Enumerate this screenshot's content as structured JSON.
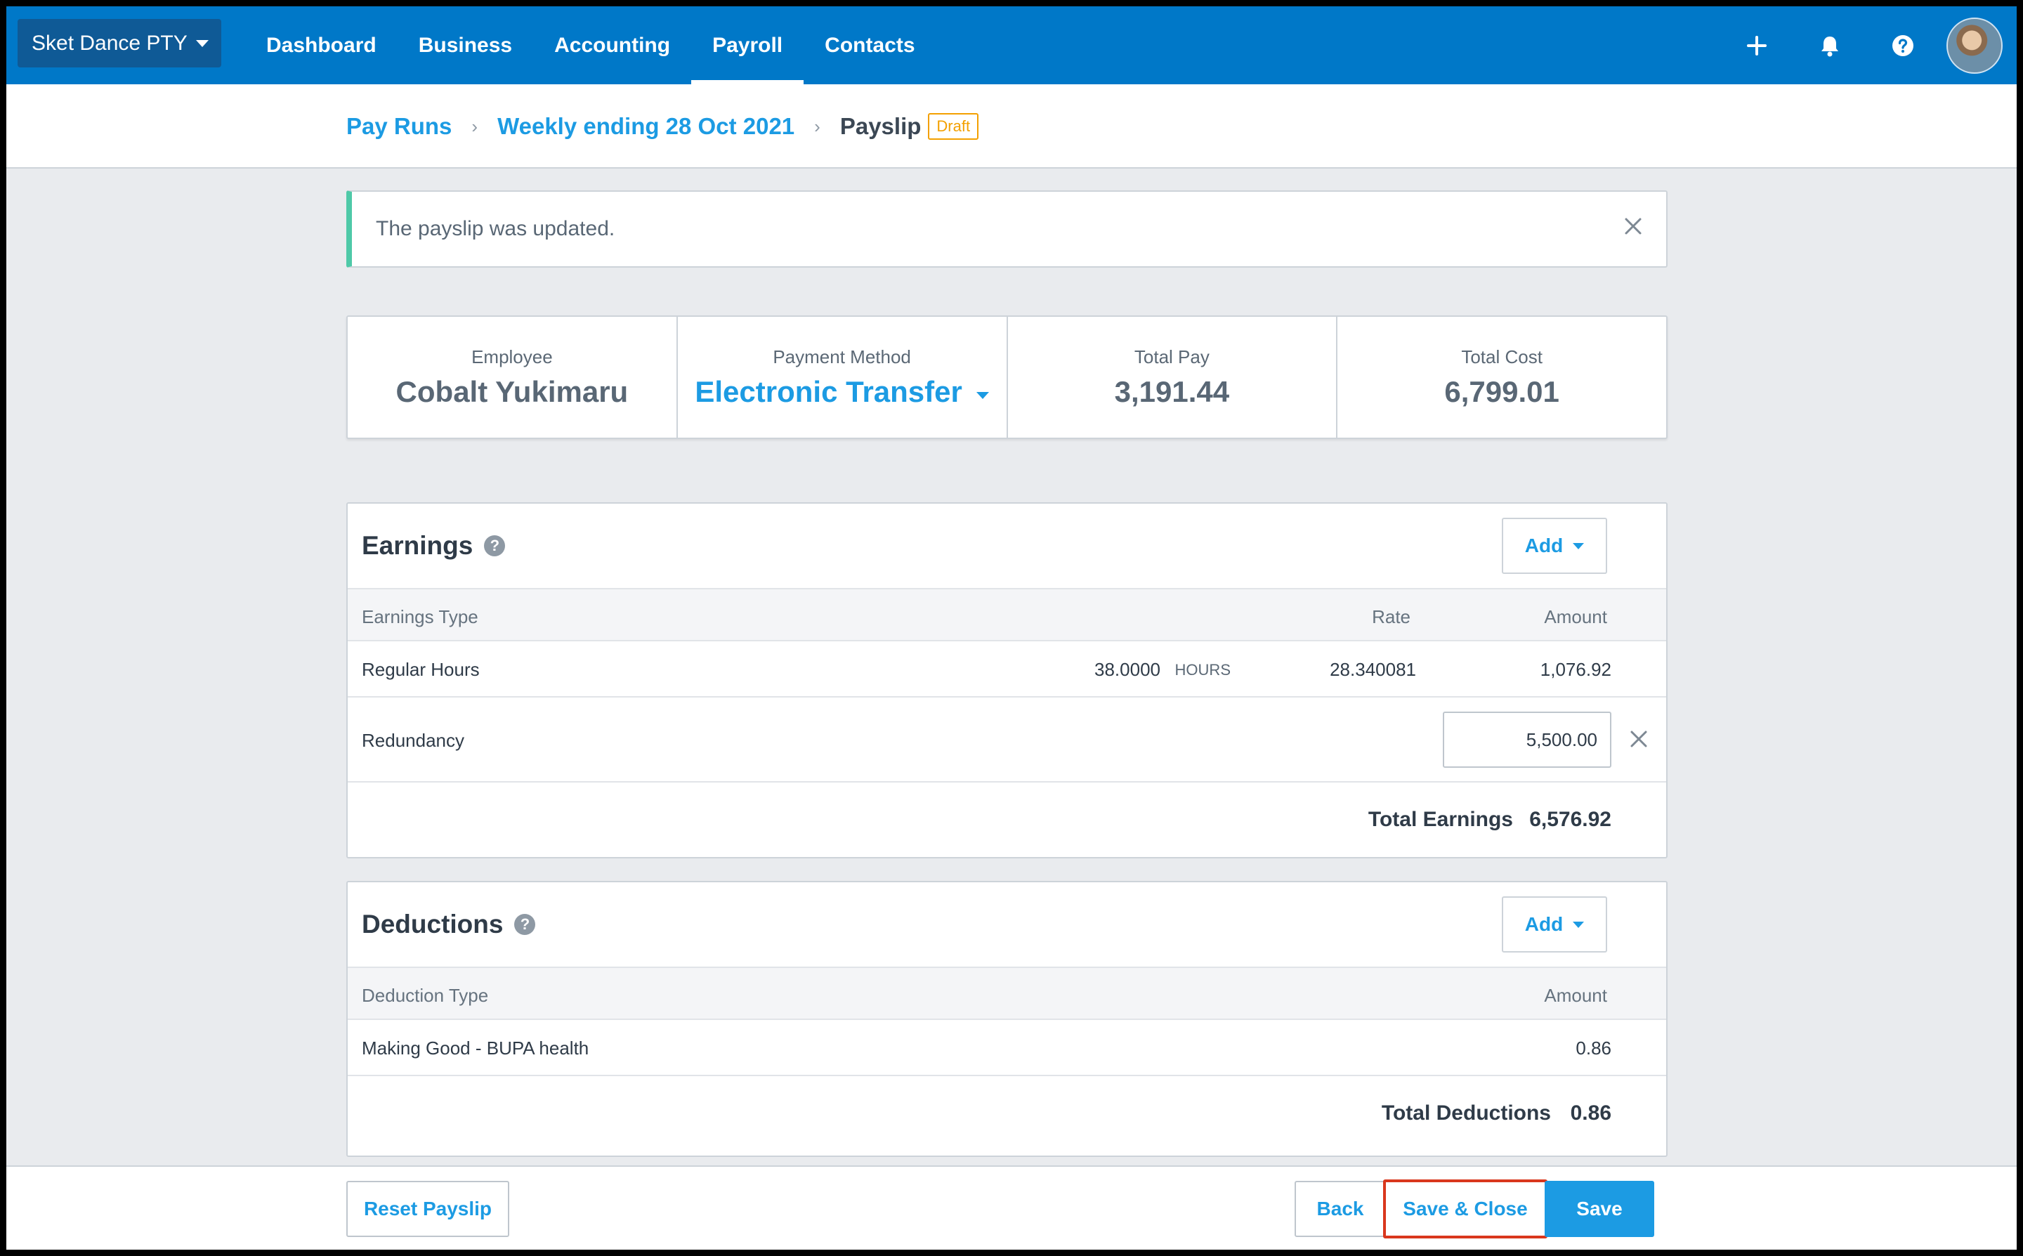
{
  "topbar": {
    "org_name": "Sket Dance PTY",
    "nav": [
      {
        "label": "Dashboard"
      },
      {
        "label": "Business"
      },
      {
        "label": "Accounting"
      },
      {
        "label": "Payroll",
        "active": true
      },
      {
        "label": "Contacts"
      }
    ],
    "icons": [
      "plus-icon",
      "bell-icon",
      "help-icon",
      "avatar"
    ]
  },
  "breadcrumb": {
    "items": [
      "Pay Runs",
      "Weekly ending 28 Oct 2021"
    ],
    "current": "Payslip",
    "badge": "Draft"
  },
  "notice": {
    "message": "The payslip was updated."
  },
  "summary": {
    "employee_label": "Employee",
    "employee_value": "Cobalt Yukimaru",
    "payment_method_label": "Payment Method",
    "payment_method_value": "Electronic Transfer",
    "total_pay_label": "Total Pay",
    "total_pay_value": "3,191.44",
    "total_cost_label": "Total Cost",
    "total_cost_value": "6,799.01"
  },
  "earnings": {
    "title": "Earnings",
    "add_label": "Add",
    "columns": {
      "type": "Earnings Type",
      "rate": "Rate",
      "amount": "Amount"
    },
    "rows": [
      {
        "type": "Regular Hours",
        "qty": "38.0000",
        "unit": "HOURS",
        "rate": "28.340081",
        "amount": "1,076.92"
      },
      {
        "type": "Redundancy",
        "amount": "5,500.00"
      }
    ],
    "total_label": "Total Earnings",
    "total_value": "6,576.92"
  },
  "deductions": {
    "title": "Deductions",
    "add_label": "Add",
    "columns": {
      "type": "Deduction Type",
      "amount": "Amount"
    },
    "rows": [
      {
        "type": "Making Good - BUPA health",
        "amount": "0.86"
      }
    ],
    "total_label": "Total Deductions",
    "total_value": "0.86"
  },
  "footer": {
    "reset_label": "Reset Payslip",
    "back_label": "Back",
    "save_close_label": "Save & Close",
    "save_label": "Save"
  },
  "colors": {
    "brand": "#0078c8",
    "link": "#1c9be3",
    "success": "#4fc9a8",
    "draft": "#f3a000",
    "highlight": "#d9371d"
  }
}
